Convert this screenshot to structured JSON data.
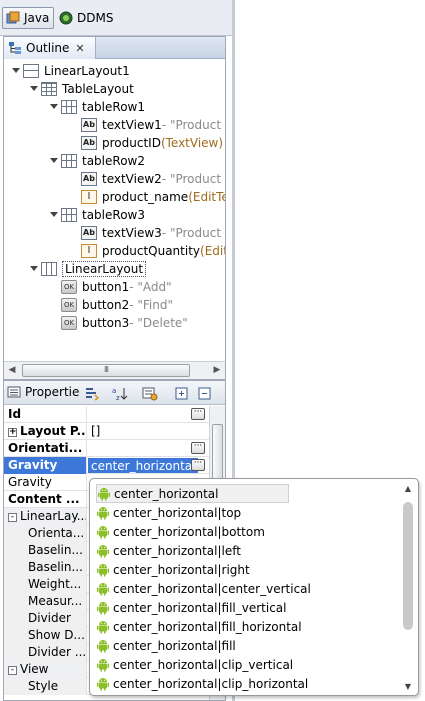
{
  "perspectives": {
    "java_label": "Java",
    "ddms_label": "DDMS"
  },
  "outline": {
    "tab_title": "Outline",
    "tree": [
      {
        "label": "LinearLayout1",
        "hint": "",
        "type_hint": "",
        "icon": "layout-icon",
        "level": 0,
        "expanded": true
      },
      {
        "label": "TableLayout",
        "hint": "",
        "type_hint": "",
        "icon": "table-layout-icon",
        "level": 1,
        "expanded": true
      },
      {
        "label": "tableRow1",
        "hint": "",
        "type_hint": "",
        "icon": "table-row-icon",
        "level": 2,
        "expanded": true
      },
      {
        "label": "textView1",
        "hint": " - \"Product I",
        "type_hint": "",
        "icon": "text-view-icon",
        "level": 3
      },
      {
        "label": "productID",
        "hint": "",
        "type_hint": " (TextView)",
        "icon": "text-view-icon",
        "level": 3
      },
      {
        "label": "tableRow2",
        "hint": "",
        "type_hint": "",
        "icon": "table-row-icon",
        "level": 2,
        "expanded": true
      },
      {
        "label": "textView2",
        "hint": " - \"Product N",
        "type_hint": "",
        "icon": "text-view-icon",
        "level": 3
      },
      {
        "label": "product_name",
        "hint": "",
        "type_hint": " (EditTe",
        "icon": "edit-text-icon",
        "level": 3
      },
      {
        "label": "tableRow3",
        "hint": "",
        "type_hint": "",
        "icon": "table-row-icon",
        "level": 2,
        "expanded": true
      },
      {
        "label": "textView3",
        "hint": " - \"Product C",
        "type_hint": "",
        "icon": "text-view-icon",
        "level": 3
      },
      {
        "label": "productQuantity",
        "hint": "",
        "type_hint": " (Edit",
        "icon": "edit-text-icon",
        "level": 3
      },
      {
        "label": "LinearLayout",
        "hint": "",
        "type_hint": "",
        "icon": "vertical-layout-icon",
        "level": 1,
        "expanded": true
      },
      {
        "label": "button1",
        "hint": " - \"Add\"",
        "type_hint": "",
        "icon": "button-icon",
        "level": 2
      },
      {
        "label": "button2",
        "hint": " - \"Find\"",
        "type_hint": "",
        "icon": "button-icon",
        "level": 2
      },
      {
        "label": "button3",
        "hint": " - \"Delete\"",
        "type_hint": "",
        "icon": "button-icon",
        "level": 2
      }
    ],
    "hscroll_grip": "III"
  },
  "properties": {
    "tab_title": "Propertie",
    "rows": [
      {
        "name": "Id",
        "value": "",
        "style": "bold",
        "dots": true,
        "expander": ""
      },
      {
        "name": "Layout P...",
        "value": "[]",
        "style": "bold",
        "dots": false,
        "expander": "+"
      },
      {
        "name": "Orientati...",
        "value": "",
        "style": "bold",
        "dots": true,
        "expander": ""
      },
      {
        "name": "Gravity",
        "value": "center_horizontal",
        "style": "selected",
        "dots": true,
        "expander": ""
      },
      {
        "name": "Gravity",
        "value": "",
        "style": "normal",
        "dots": false,
        "expander": ""
      },
      {
        "name": "Content ...",
        "value": "",
        "style": "bold",
        "dots": true,
        "expander": ""
      },
      {
        "name": "LinearLay...",
        "value": "",
        "style": "category",
        "dots": false,
        "expander": "-"
      },
      {
        "name": "Orienta...",
        "value": "",
        "style": "indent",
        "dots": false,
        "expander": ""
      },
      {
        "name": "Baselin...",
        "value": "",
        "style": "indent",
        "dots": false,
        "expander": ""
      },
      {
        "name": "Baselin...",
        "value": "",
        "style": "indent",
        "dots": false,
        "expander": ""
      },
      {
        "name": "Weight...",
        "value": "",
        "style": "indent",
        "dots": false,
        "expander": ""
      },
      {
        "name": "Measur...",
        "value": "",
        "style": "indent",
        "dots": false,
        "expander": ""
      },
      {
        "name": "Divider",
        "value": "",
        "style": "indent",
        "dots": false,
        "expander": ""
      },
      {
        "name": "Show D...",
        "value": "",
        "style": "indent",
        "dots": false,
        "expander": ""
      },
      {
        "name": "Divider ...",
        "value": "",
        "style": "indent",
        "dots": false,
        "expander": ""
      },
      {
        "name": "View",
        "value": "",
        "style": "category",
        "dots": false,
        "expander": "-"
      },
      {
        "name": "Style",
        "value": "",
        "style": "indent",
        "dots": false,
        "expander": ""
      }
    ]
  },
  "gravity_popup": {
    "options": [
      "center_horizontal",
      "center_horizontal|top",
      "center_horizontal|bottom",
      "center_horizontal|left",
      "center_horizontal|right",
      "center_horizontal|center_vertical",
      "center_horizontal|fill_vertical",
      "center_horizontal|fill_horizontal",
      "center_horizontal|fill",
      "center_horizontal|clip_vertical",
      "center_horizontal|clip_horizontal"
    ]
  },
  "colors": {
    "selection": "#3d78d8",
    "android_green": "#8cbf26",
    "hint_gray": "#8a8a8a",
    "type_hint_brown": "#a06a1e"
  }
}
